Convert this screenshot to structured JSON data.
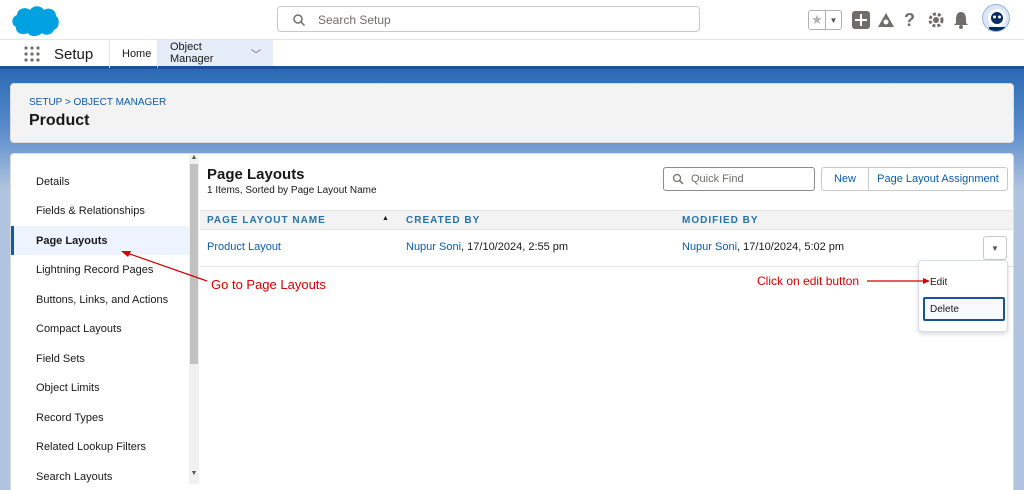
{
  "header": {
    "search_placeholder": "Search Setup",
    "app_title": "Setup",
    "nav": [
      {
        "label": "Home"
      },
      {
        "label": "Object Manager"
      }
    ]
  },
  "page": {
    "breadcrumb": "SETUP > OBJECT MANAGER",
    "title": "Product"
  },
  "sidebar": {
    "items": [
      {
        "label": "Details"
      },
      {
        "label": "Fields & Relationships"
      },
      {
        "label": "Page Layouts"
      },
      {
        "label": "Lightning Record Pages"
      },
      {
        "label": "Buttons, Links, and Actions"
      },
      {
        "label": "Compact Layouts"
      },
      {
        "label": "Field Sets"
      },
      {
        "label": "Object Limits"
      },
      {
        "label": "Record Types"
      },
      {
        "label": "Related Lookup Filters"
      },
      {
        "label": "Search Layouts"
      }
    ],
    "active_index": 2
  },
  "section": {
    "title": "Page Layouts",
    "subtitle": "1 Items, Sorted by Page Layout Name",
    "quick_find_placeholder": "Quick Find",
    "new_label": "New",
    "assignment_label": "Page Layout Assignment"
  },
  "table": {
    "columns": [
      "PAGE LAYOUT NAME",
      "CREATED BY",
      "MODIFIED BY"
    ],
    "rows": [
      {
        "name": "Product Layout",
        "created_by_user": "Nupur Soni",
        "created_by_date": ", 17/10/2024, 2:55 pm",
        "modified_by_user": "Nupur Soni",
        "modified_by_date": ", 17/10/2024, 5:02 pm"
      }
    ]
  },
  "row_menu": {
    "edit_label": "Edit",
    "delete_label": "Delete"
  },
  "annotations": {
    "goto": "Go to Page Layouts",
    "click_edit": "Click on edit button"
  },
  "colors": {
    "brand": "#0b5cab",
    "nav_accent": "#1b5297",
    "annotation": "#d40000"
  },
  "icons": [
    "salesforce-cloud-logo",
    "search-icon",
    "star-icon",
    "add-icon",
    "trailhead-icon",
    "help-icon",
    "gear-icon",
    "bell-icon",
    "avatar",
    "app-launcher-icon"
  ]
}
